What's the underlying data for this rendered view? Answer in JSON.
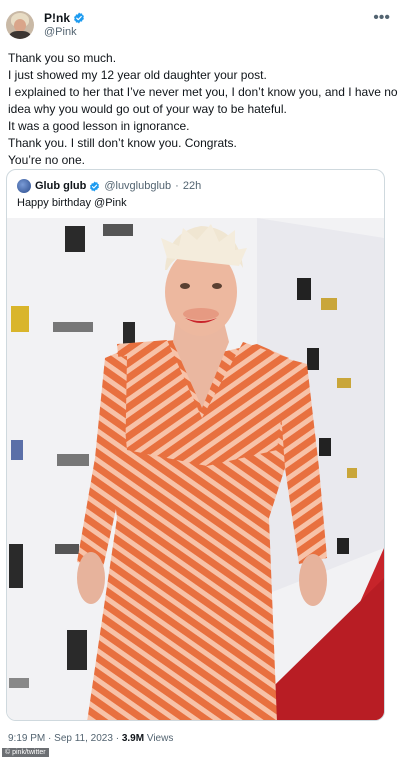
{
  "author": {
    "display_name": "P!nk",
    "handle": "@Pink",
    "verified_color": "#1d9bf0",
    "more_icon": "more-horizontal-icon"
  },
  "tweet": {
    "lines": [
      "Thank you so much.",
      "I just showed my 12 year old daughter your post.",
      "I explained to her that I’ve never met you, I don’t know you, and I have no",
      "idea why you would go out of your way to be hateful.",
      "It was a good lesson in ignorance.",
      "Thank you. I still don’t know you. Congrats.",
      "You’re no one."
    ]
  },
  "quote": {
    "display_name": "Glub glub",
    "handle": "@luvglubglub",
    "separator": "·",
    "time": "22h",
    "text": "Happy birthday @Pink",
    "photo_icon": "photo-red-carpet-person"
  },
  "meta": {
    "time": "9:19 PM",
    "separator": "·",
    "date": "Sep 11, 2023",
    "views_count": "3.9M",
    "views_label": "Views"
  },
  "credit": "© pink/twitter",
  "colors": {
    "text": "#0f1419",
    "secondary": "#536471",
    "border": "#cfd9de",
    "dress_orange": "#e8703f",
    "dress_stripe": "#f7c2a8",
    "carpet": "#c7242a"
  }
}
